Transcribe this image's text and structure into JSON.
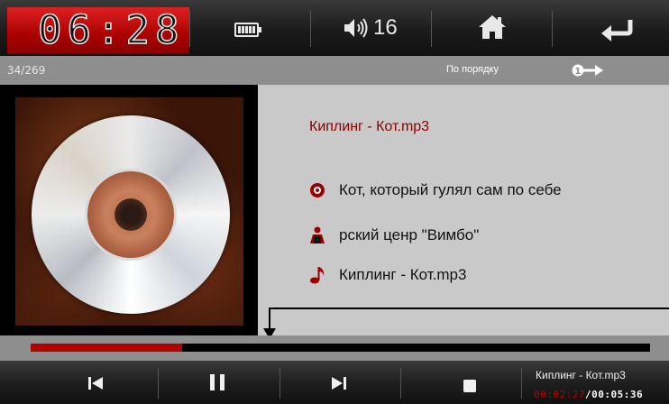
{
  "status": {
    "clock": "06:28",
    "battery_icon": "battery-full-icon",
    "volume_icon": "speaker-volume-icon",
    "volume": "16",
    "home_icon": "home-icon",
    "back_icon": "back-arrow-icon"
  },
  "info": {
    "track_position": "34/269",
    "play_order": "По порядку",
    "order_icon": "sequential-order-icon"
  },
  "track": {
    "title": "Киплинг - Кот.mp3",
    "album": "Кот, который гулял сам по себе",
    "artist": "рский ценр \"Вимбо\"",
    "file": "Киплинг - Кот.mp3",
    "album_icon": "disc-icon",
    "artist_icon": "person-icon",
    "file_icon": "music-note-icon"
  },
  "progress": {
    "fraction": 0.245
  },
  "controls": {
    "prev_icon": "skip-previous-icon",
    "pause_icon": "pause-icon",
    "next_icon": "skip-next-icon",
    "stop_icon": "stop-icon"
  },
  "now_playing": {
    "title": "Киплинг - Кот.mp3",
    "elapsed": "00:02:27",
    "separator": "/",
    "total": "00:05:36"
  },
  "colors": {
    "accent_red": "#b00000",
    "title_red": "#8b0000",
    "panel_gray": "#c9c9c9",
    "bar_gray": "#8e8e8e"
  }
}
